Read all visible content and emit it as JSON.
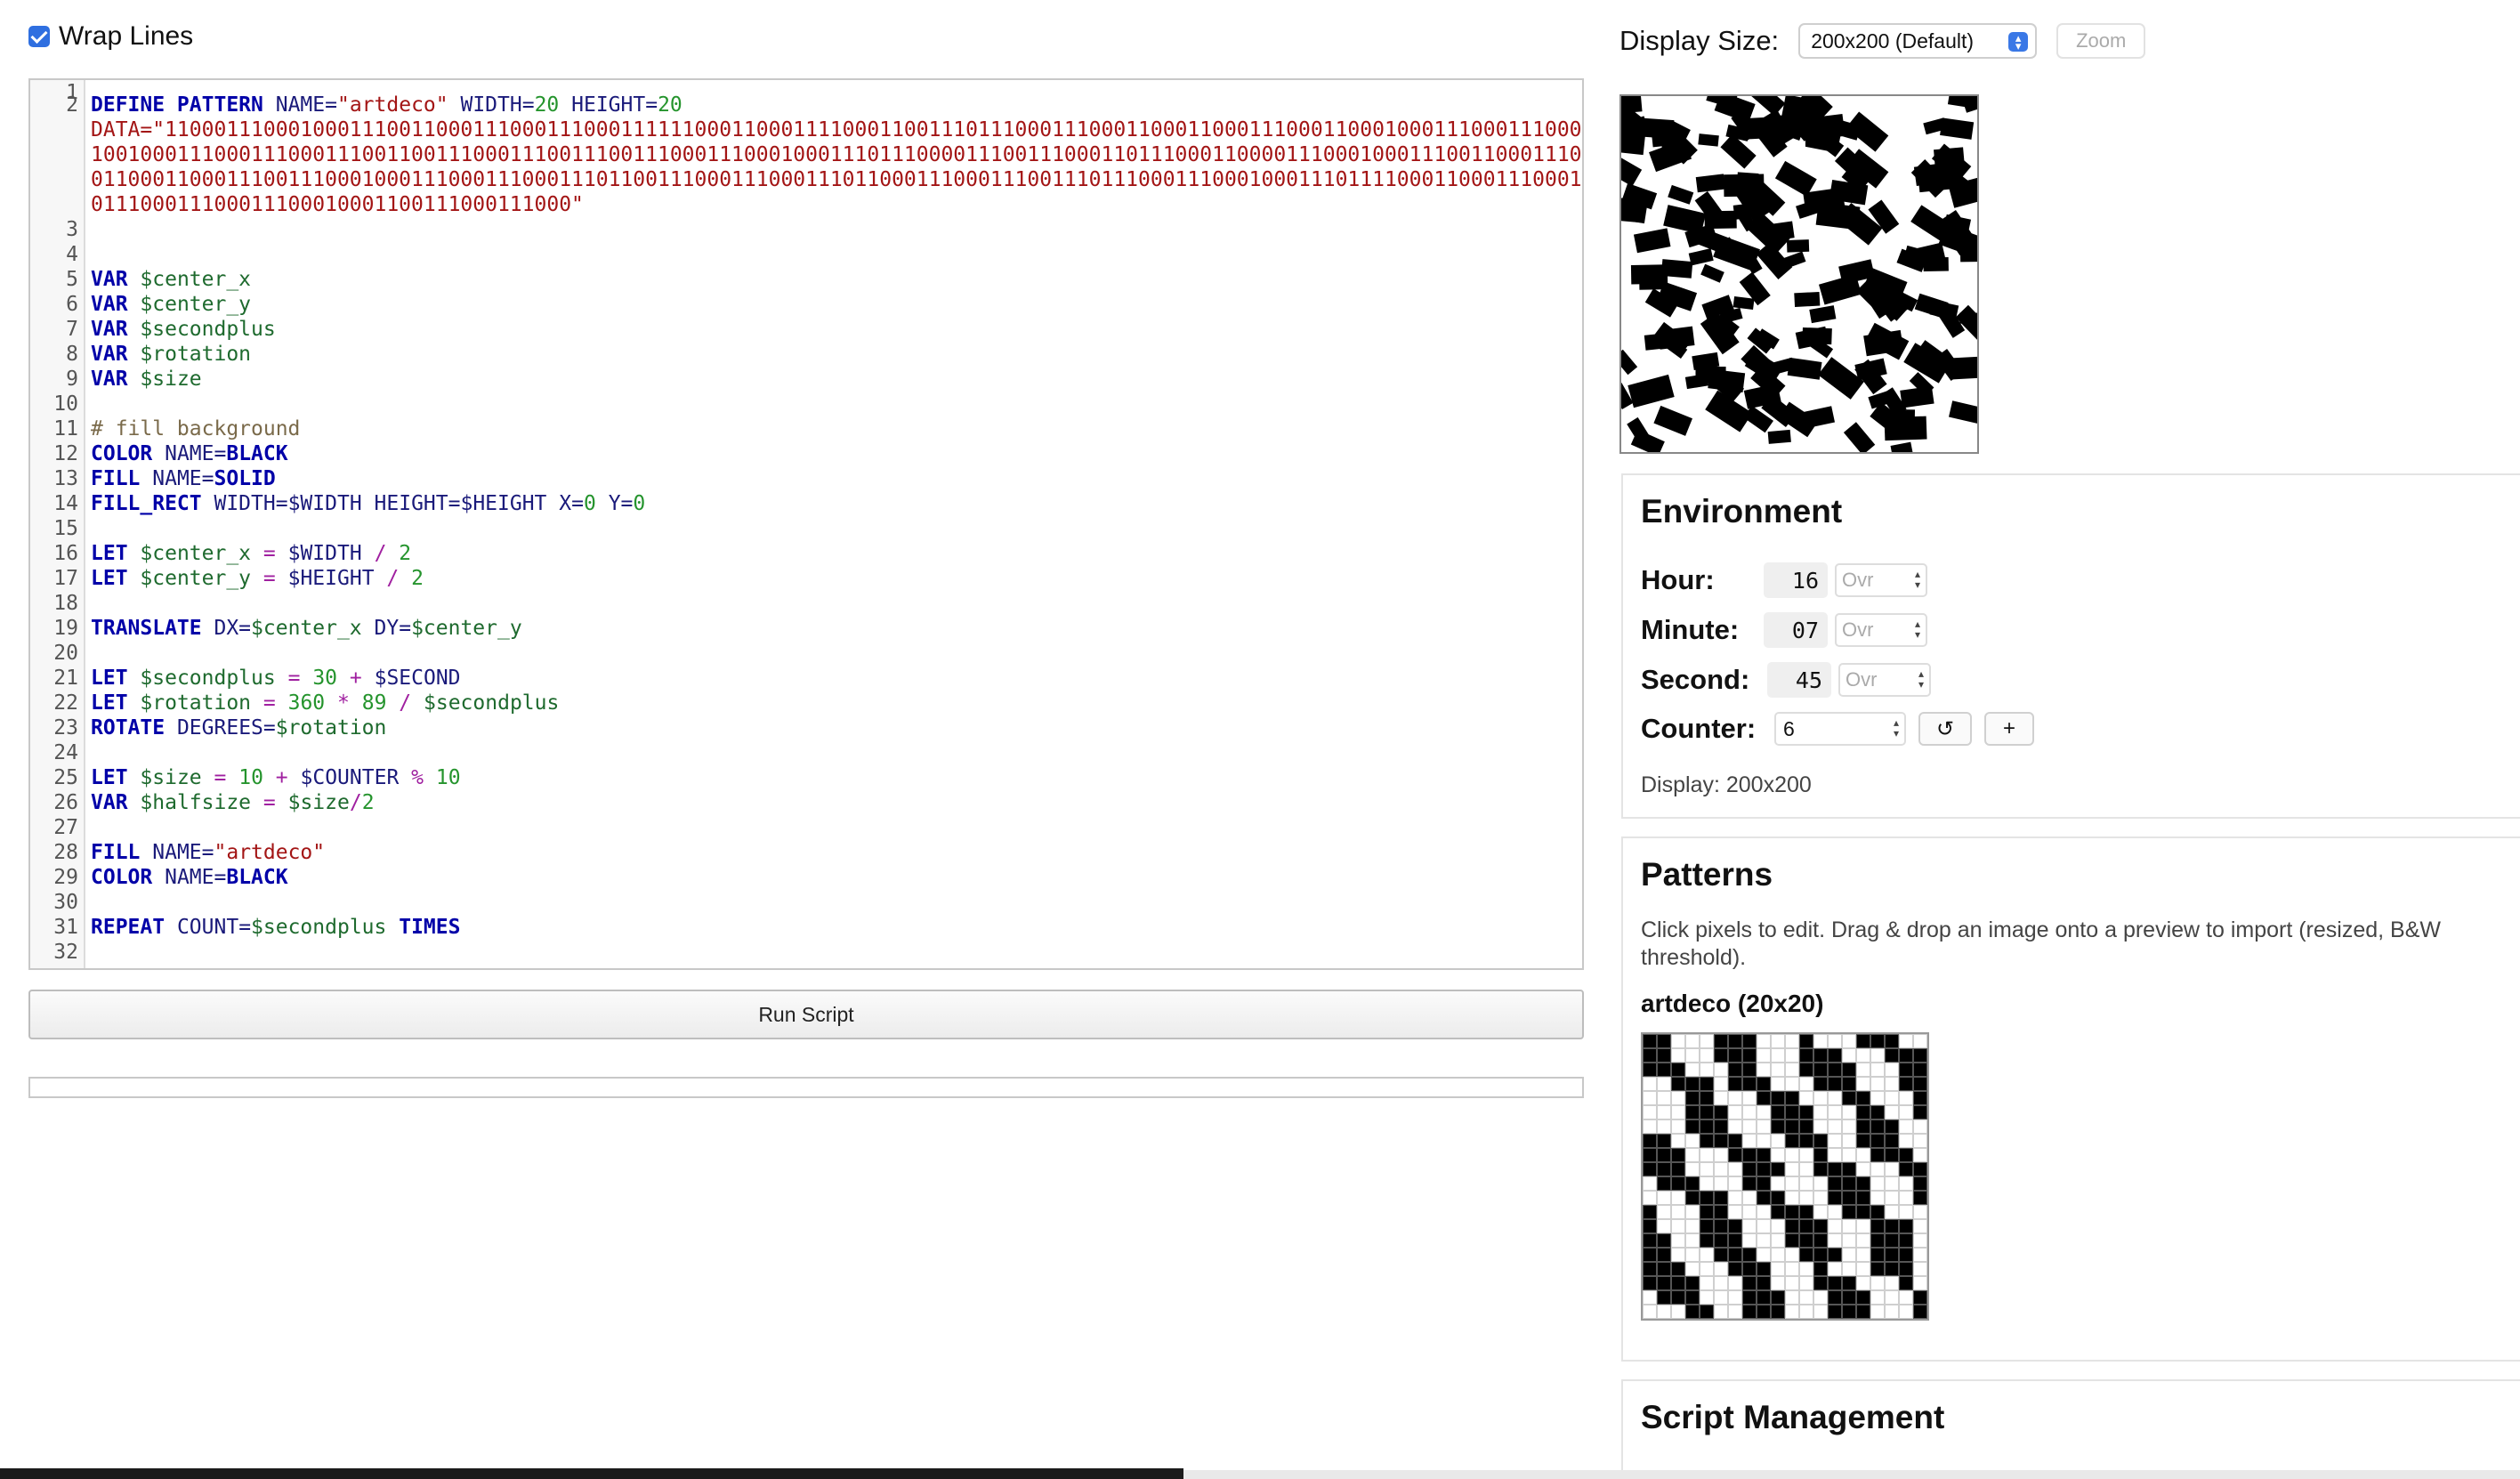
{
  "editor": {
    "wrap_label": "Wrap Lines",
    "line_numbers": [
      "1",
      "2",
      "3",
      "4",
      "5",
      "6",
      "7",
      "8",
      "9",
      "10",
      "11",
      "12",
      "13",
      "14",
      "15",
      "16",
      "17",
      "18",
      "19",
      "20",
      "21",
      "22",
      "23",
      "24",
      "25",
      "26",
      "27",
      "28",
      "29",
      "30",
      "31",
      "32"
    ],
    "define_line": {
      "kw1": "DEFINE PATTERN",
      "attr_name": "NAME=",
      "name_val": "\"artdeco\"",
      "attr_width": "WIDTH=",
      "width_val": "20",
      "attr_height": "HEIGHT=",
      "height_val": "20"
    },
    "data_line": "DATA=\"110001110001000111001100011100011100011111100011000111100011001110111000111000110001100011100011000100011100011100011001000111000111000111001100111000111001110011100011100010001110111000011100111000110111000110000111000100011100110001110001100011000111001110001000111000111000111011001110001110001110110001110001110011101110001110001000111011110001100011100010011100011100011100010001100111000111000\"",
    "vars": [
      "$center_x",
      "$center_y",
      "$secondplus",
      "$rotation",
      "$size"
    ],
    "var_kw": "VAR",
    "comment": "# fill background",
    "color_kw": "COLOR",
    "fill_kw": "FILL",
    "fillrect_kw": "FILL_RECT",
    "let_kw": "LET",
    "translate_kw": "TRANSLATE",
    "rotate_kw": "ROTATE",
    "repeat_kw": "REPEAT",
    "times_kw": "TIMES",
    "l12": {
      "attr": "NAME=",
      "val": "BLACK"
    },
    "l13": {
      "attr": "NAME=",
      "val": "SOLID"
    },
    "l14": {
      "a1": "WIDTH=",
      "v1": "$WIDTH",
      "a2": "HEIGHT=",
      "v2": "$HEIGHT",
      "a3": "X=",
      "v3": "0",
      "a4": "Y=",
      "v4": "0"
    },
    "l16": {
      "var": "$center_x",
      "eq": "=",
      "v1": "$WIDTH",
      "op": "/",
      "n": "2"
    },
    "l17": {
      "var": "$center_y",
      "eq": "=",
      "v1": "$HEIGHT",
      "op": "/",
      "n": "2"
    },
    "l19": {
      "a1": "DX=",
      "v1": "$center_x",
      "a2": "DY=",
      "v2": "$center_y"
    },
    "l21": {
      "var": "$secondplus",
      "eq": "=",
      "n": "30",
      "op": "+",
      "v1": "$SECOND"
    },
    "l22": {
      "var": "$rotation",
      "eq": "=",
      "n1": "360",
      "op1": "*",
      "n2": "89",
      "op2": "/",
      "v1": "$secondplus"
    },
    "l23": {
      "attr": "DEGREES=",
      "val": "$rotation"
    },
    "l25": {
      "var": "$size",
      "eq": "=",
      "n1": "10",
      "op1": "+",
      "v1": "$COUNTER",
      "op2": "%",
      "n2": "10"
    },
    "l26": {
      "var": "$halfsize",
      "eq": "=",
      "v1": "$size",
      "op": "/",
      "n": "2"
    },
    "l28": {
      "attr": "NAME=",
      "val": "\"artdeco\""
    },
    "l29": {
      "attr": "NAME=",
      "val": "BLACK"
    },
    "l31": {
      "attr": "COUNT=",
      "val": "$secondplus"
    },
    "run_label": "Run Script"
  },
  "display": {
    "label": "Display Size:",
    "selected": "200x200 (Default)",
    "zoom_label": "Zoom"
  },
  "environment": {
    "title": "Environment",
    "hour_label": "Hour:",
    "hour": "16",
    "minute_label": "Minute:",
    "minute": "07",
    "second_label": "Second:",
    "second": "45",
    "ovr_placeholder": "Ovr",
    "counter_label": "Counter:",
    "counter": "6",
    "reset_icon": "↺",
    "plus_label": "+",
    "display_text": "Display: 200x200"
  },
  "patterns": {
    "title": "Patterns",
    "hint": "Click pixels to edit. Drag & drop an image onto a preview to import (resized, B&W threshold).",
    "pattern_name": "artdeco (20x20)",
    "bits": "1100011100010001110011000111000111000111111000110001111000110011101110001110001100011000111000110001000111000111000110010001110001110001110011001110001110011100111000111000100011101110000111001110001101110001100001110001000111001100011100011000110001110011100010001110001110001110110011100011100011101100011100011100111011100011100010001110111100011000111000100111000111000111000100011001110001110001"
  },
  "script_mgmt": {
    "title": "Script Management"
  }
}
